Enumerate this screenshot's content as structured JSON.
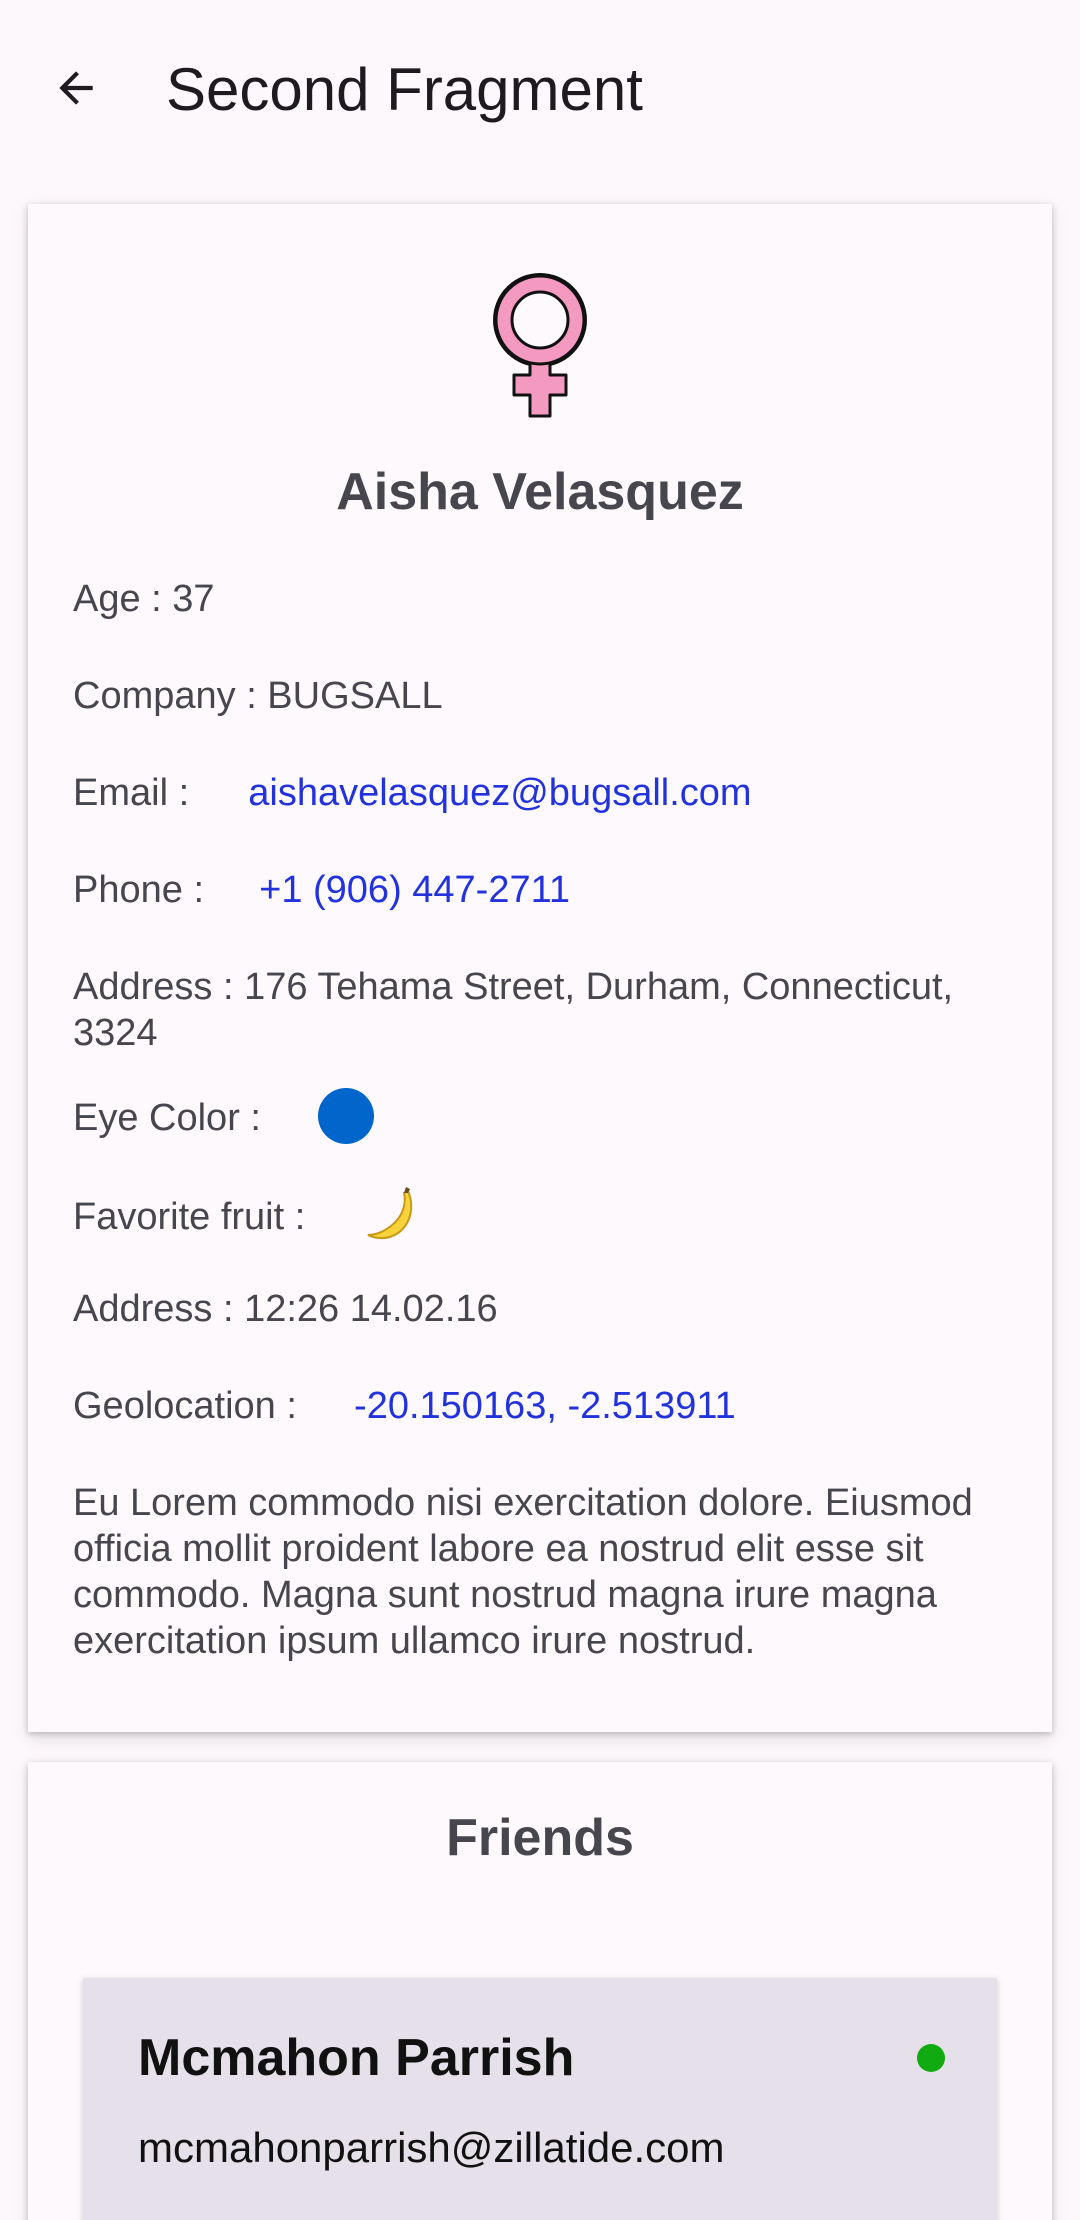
{
  "appbar": {
    "title": "Second Fragment",
    "back_icon": "arrow-back-icon"
  },
  "profile": {
    "gender_icon": "female-sign-icon",
    "gender_color": "#f49ac1",
    "name": "Aisha Velasquez",
    "age": "Age : 37",
    "company": "Company : BUGSALL",
    "email_label": "Email :",
    "email": "aishavelasquez@bugsall.com",
    "phone_label": "Phone :",
    "phone": "+1 (906) 447-2711",
    "address": "Address : 176 Tehama Street, Durham, Connecticut, 3324",
    "eye_color_label": "Eye Color :",
    "eye_color": "#0066cc",
    "favorite_fruit_label": "Favorite fruit :",
    "favorite_fruit_icon": "banana-icon",
    "registered": "Address : 12:26 14.02.16",
    "geolocation_label": "Geolocation :",
    "geolocation": "-20.150163, -2.513911",
    "about": "Eu Lorem commodo nisi exercitation dolore. Eiusmod officia mollit proident labore ea nostrud elit esse sit commodo. Magna sunt nostrud magna irure magna exercitation ipsum ullamco irure nostrud."
  },
  "friends": {
    "title": "Friends",
    "items": [
      {
        "name": "Mcmahon Parrish",
        "email": "mcmahonparrish@zillatide.com",
        "status_color": "#11aa11"
      }
    ]
  },
  "colors": {
    "link": "#2233dd",
    "text": "#47464f",
    "background": "#fdf8fc",
    "friend_card": "#e5e0e9"
  }
}
